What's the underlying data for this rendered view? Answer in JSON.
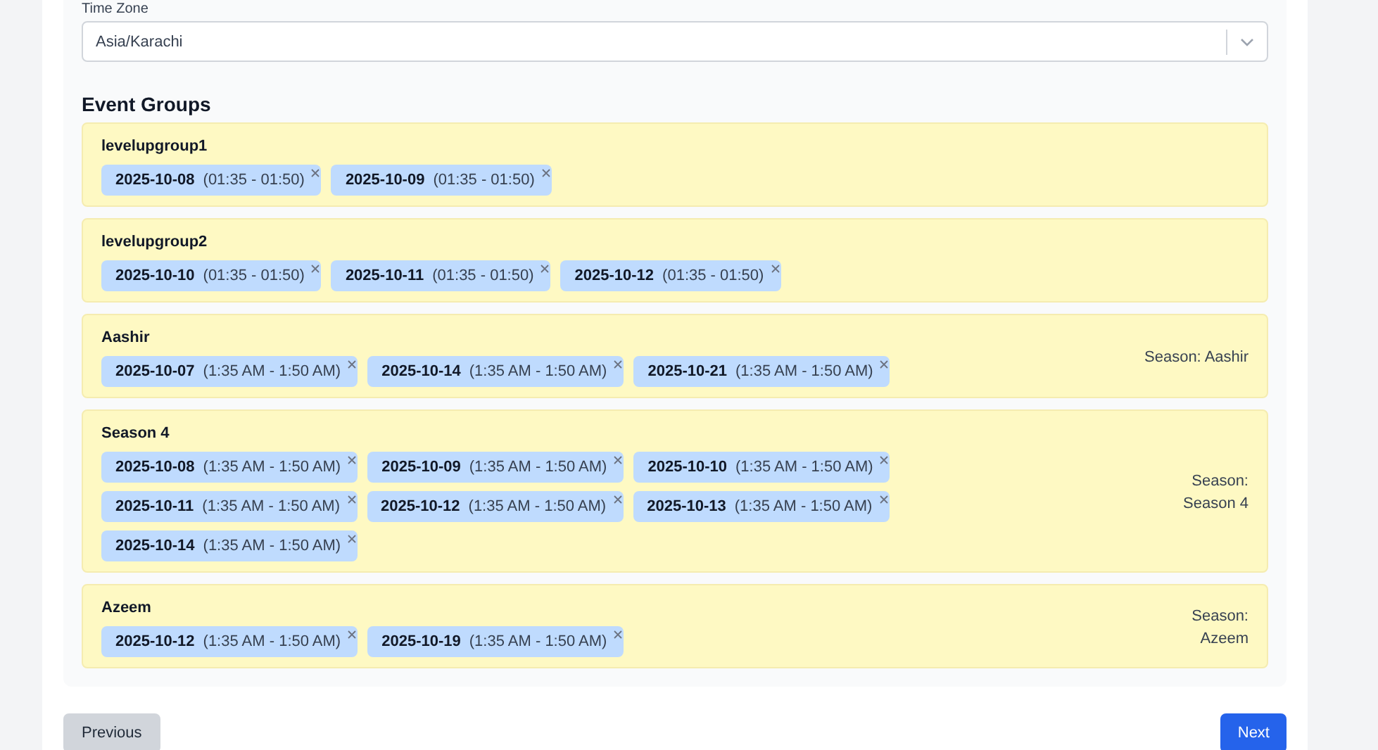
{
  "time_zone": {
    "label": "Time Zone",
    "value": "Asia/Karachi"
  },
  "section_title": "Event Groups",
  "groups": [
    {
      "name": "levelupgroup1",
      "tags": [
        {
          "date": "2025-10-08",
          "time": "(01:35 - 01:50)"
        },
        {
          "date": "2025-10-09",
          "time": "(01:35 - 01:50)"
        }
      ]
    },
    {
      "name": "levelupgroup2",
      "tags": [
        {
          "date": "2025-10-10",
          "time": "(01:35 - 01:50)"
        },
        {
          "date": "2025-10-11",
          "time": "(01:35 - 01:50)"
        },
        {
          "date": "2025-10-12",
          "time": "(01:35 - 01:50)"
        }
      ]
    },
    {
      "name": "Aashir",
      "season": "Season: Aashir",
      "tags": [
        {
          "date": "2025-10-07",
          "time": "(1:35 AM - 1:50 AM)"
        },
        {
          "date": "2025-10-14",
          "time": "(1:35 AM - 1:50 AM)"
        },
        {
          "date": "2025-10-21",
          "time": "(1:35 AM - 1:50 AM)"
        }
      ]
    },
    {
      "name": "Season 4",
      "season": "Season: Season 4",
      "tags": [
        {
          "date": "2025-10-08",
          "time": "(1:35 AM - 1:50 AM)"
        },
        {
          "date": "2025-10-09",
          "time": "(1:35 AM - 1:50 AM)"
        },
        {
          "date": "2025-10-10",
          "time": "(1:35 AM - 1:50 AM)"
        },
        {
          "date": "2025-10-11",
          "time": "(1:35 AM - 1:50 AM)"
        },
        {
          "date": "2025-10-12",
          "time": "(1:35 AM - 1:50 AM)"
        },
        {
          "date": "2025-10-13",
          "time": "(1:35 AM - 1:50 AM)"
        },
        {
          "date": "2025-10-14",
          "time": "(1:35 AM - 1:50 AM)"
        }
      ]
    },
    {
      "name": "Azeem",
      "season": "Season: Azeem",
      "tags": [
        {
          "date": "2025-10-12",
          "time": "(1:35 AM - 1:50 AM)"
        },
        {
          "date": "2025-10-19",
          "time": "(1:35 AM - 1:50 AM)"
        }
      ]
    }
  ],
  "buttons": {
    "previous": "Previous",
    "next": "Next"
  }
}
